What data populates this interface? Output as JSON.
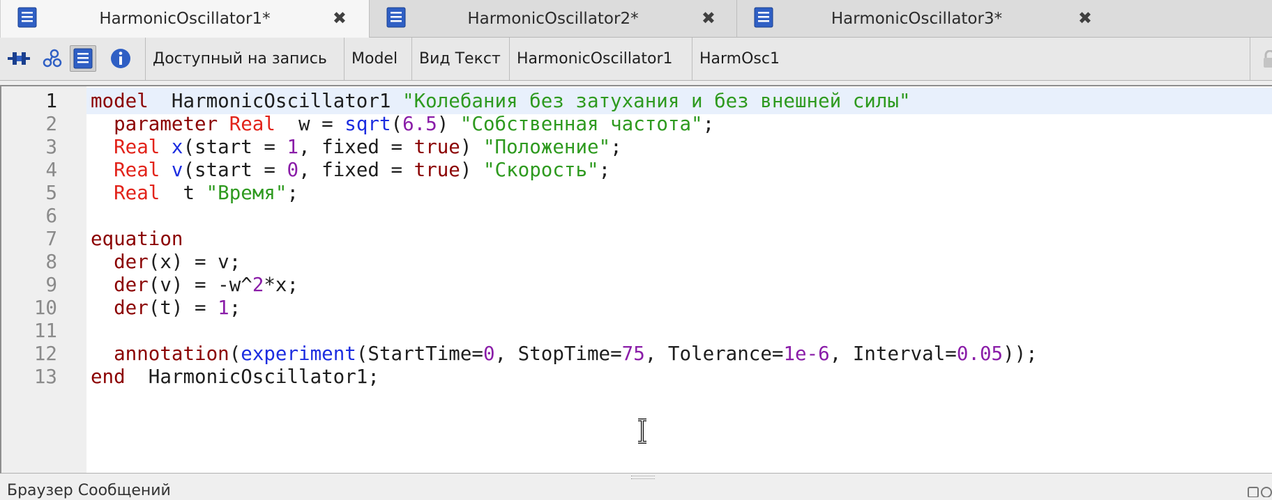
{
  "tabs": [
    {
      "label": "HarmonicOscillator1*",
      "active": true
    },
    {
      "label": "HarmonicOscillator2*",
      "active": false
    },
    {
      "label": "HarmonicOscillator3*",
      "active": false
    }
  ],
  "tab_close_glyph": "✖",
  "toolbar": {
    "icons": [
      "diagram-view-icon",
      "icon-view-icon",
      "text-view-icon",
      "documentation-view-icon"
    ],
    "access": "Доступный на запись",
    "restriction": "Model",
    "view": "Вид Текст",
    "class_name": "HarmonicOscillator1",
    "file_name": "HarmOsc1"
  },
  "editor": {
    "line_numbers": [
      "1",
      "2",
      "3",
      "4",
      "5",
      "6",
      "7",
      "8",
      "9",
      "10",
      "11",
      "12",
      "13"
    ],
    "current_line": 1,
    "lines": [
      [
        [
          "kw",
          "model"
        ],
        [
          "",
          "  HarmonicOscillator1 "
        ],
        [
          "str",
          "\"Колебания без затухания и без внешней силы\""
        ]
      ],
      [
        [
          "",
          "  "
        ],
        [
          "kw",
          "parameter"
        ],
        [
          "",
          ""
        ],
        [
          "ty",
          " Real"
        ],
        [
          "",
          ""
        ],
        [
          "",
          "  w = "
        ],
        [
          "fn",
          "sqrt"
        ],
        [
          "",
          "("
        ],
        [
          "num",
          "6.5"
        ],
        [
          "",
          ") "
        ],
        [
          "str",
          "\"Собственная частота\""
        ],
        [
          "",
          ";"
        ]
      ],
      [
        [
          "",
          "  "
        ],
        [
          "ty",
          "Real"
        ],
        [
          "fn",
          " x"
        ],
        [
          "",
          "(start = "
        ],
        [
          "num",
          "1"
        ],
        [
          "",
          ", fixed = "
        ],
        [
          "kw",
          "true"
        ],
        [
          "",
          ") "
        ],
        [
          "str",
          "\"Положение\""
        ],
        [
          "",
          ";"
        ]
      ],
      [
        [
          "",
          "  "
        ],
        [
          "ty",
          "Real"
        ],
        [
          "fn",
          " v"
        ],
        [
          "",
          "(start = "
        ],
        [
          "num",
          "0"
        ],
        [
          "",
          ", fixed = "
        ],
        [
          "kw",
          "true"
        ],
        [
          "",
          ") "
        ],
        [
          "str",
          "\"Скорость\""
        ],
        [
          "",
          ";"
        ]
      ],
      [
        [
          "",
          "  "
        ],
        [
          "ty",
          "Real"
        ],
        [
          "",
          ""
        ],
        [
          "",
          "  t "
        ],
        [
          "str",
          "\"Время\""
        ],
        [
          "",
          ";"
        ]
      ],
      [],
      [
        [
          "kw",
          "equation"
        ]
      ],
      [
        [
          "",
          "  "
        ],
        [
          "kw",
          "der"
        ],
        [
          "",
          "(x) = v;"
        ]
      ],
      [
        [
          "",
          "  "
        ],
        [
          "kw",
          "der"
        ],
        [
          "",
          "(v) = -w^"
        ],
        [
          "num",
          "2"
        ],
        [
          "",
          "*x;"
        ]
      ],
      [
        [
          "",
          "  "
        ],
        [
          "kw",
          "der"
        ],
        [
          "",
          "(t) = "
        ],
        [
          "num",
          "1"
        ],
        [
          "",
          ";"
        ]
      ],
      [],
      [
        [
          "",
          "  "
        ],
        [
          "kw",
          "annotation"
        ],
        [
          "",
          "("
        ],
        [
          "fn",
          "experiment"
        ],
        [
          "",
          "(StartTime="
        ],
        [
          "num",
          "0"
        ],
        [
          "",
          ", StopTime="
        ],
        [
          "num",
          "75"
        ],
        [
          "",
          ", Tolerance="
        ],
        [
          "num",
          "1e-6"
        ],
        [
          "",
          ", Interval="
        ],
        [
          "num",
          "0.05"
        ],
        [
          "",
          "));"
        ]
      ],
      [
        [
          "kw",
          "end"
        ],
        [
          "",
          "  HarmonicOscillator1;"
        ]
      ]
    ]
  },
  "messages": {
    "title": "Браузер Сообщений"
  },
  "colors": {
    "keyword": "#8b0000",
    "type": "#e2231a",
    "function": "#1c2de0",
    "number": "#8a1da8",
    "string": "#2e9a1f",
    "current_line": "#e8f0fc"
  }
}
